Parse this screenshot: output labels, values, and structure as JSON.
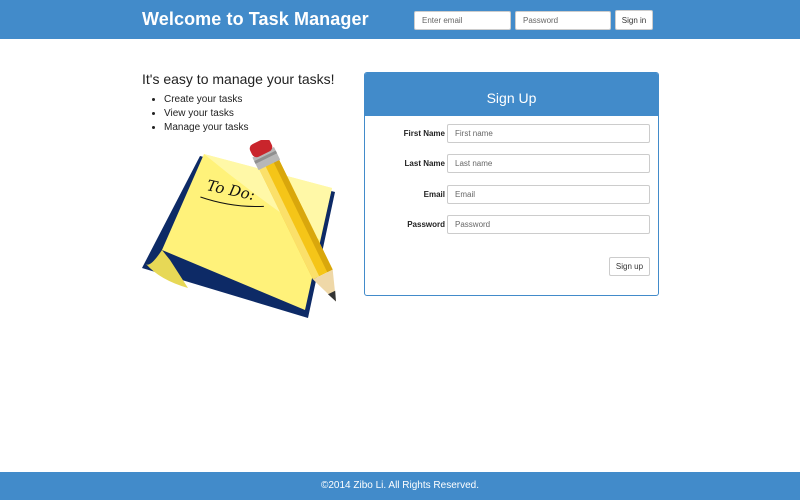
{
  "header": {
    "brand": "Welcome to Task Manager",
    "email_placeholder": "Enter email",
    "password_placeholder": "Password",
    "signin_label": "Sign in"
  },
  "intro": {
    "tagline": "It's easy to manage your tasks!",
    "features": [
      "Create your tasks",
      "View your tasks",
      "Manage your tasks"
    ],
    "note_text": "To Do:"
  },
  "signup": {
    "title": "Sign Up",
    "fields": [
      {
        "label": "First Name",
        "placeholder": "First name"
      },
      {
        "label": "Last Name",
        "placeholder": "Last name"
      },
      {
        "label": "Email",
        "placeholder": "Email"
      },
      {
        "label": "Password",
        "placeholder": "Password"
      }
    ],
    "submit_label": "Sign up"
  },
  "footer": {
    "text": "©2014 Zibo Li. All Rights Reserved."
  },
  "colors": {
    "primary": "#428bca",
    "note_yellow": "#fff27a",
    "pencil_yellow": "#f5c518",
    "eraser_red": "#c9252c"
  }
}
